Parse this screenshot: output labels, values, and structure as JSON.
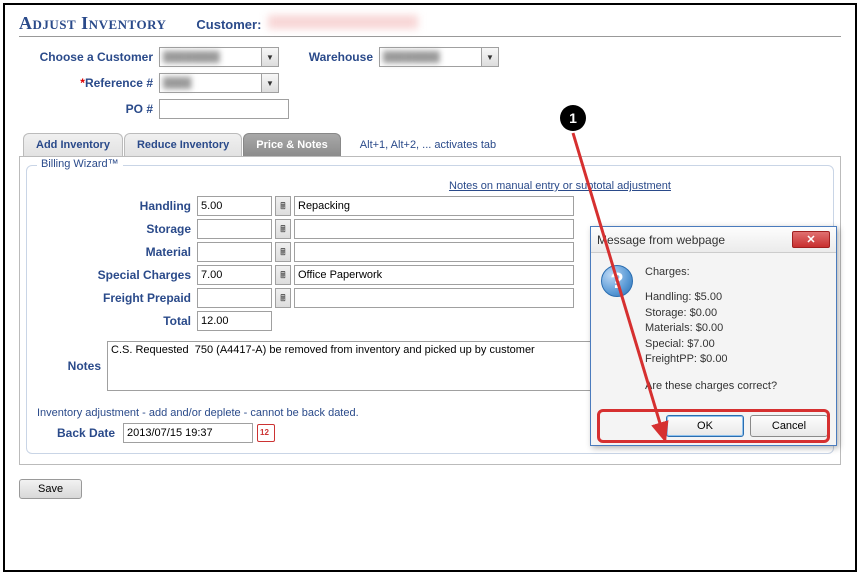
{
  "header": {
    "title": "Adjust Inventory",
    "customer_label": "Customer:"
  },
  "form": {
    "choose_customer_label": "Choose a Customer",
    "warehouse_label": "Warehouse",
    "reference_label": "Reference #",
    "po_label": "PO #"
  },
  "tabs": {
    "add": "Add Inventory",
    "reduce": "Reduce Inventory",
    "price": "Price & Notes",
    "hint": "Alt+1, Alt+2, ... activates tab"
  },
  "billing": {
    "legend": "Billing Wizard™",
    "notes_header": "Notes on manual entry or subtotal adjustment",
    "handling_label": "Handling",
    "handling_value": "5.00",
    "handling_note": "Repacking",
    "storage_label": "Storage",
    "storage_value": "",
    "storage_note": "",
    "material_label": "Material",
    "material_value": "",
    "material_note": "",
    "special_label": "Special Charges",
    "special_value": "7.00",
    "special_note": "Office Paperwork",
    "freight_label": "Freight Prepaid",
    "freight_value": "",
    "freight_note": "",
    "total_label": "Total",
    "total_value": "12.00"
  },
  "notes": {
    "label": "Notes",
    "value": "C.S. Requested  750 (A4417-A) be removed from inventory and picked up by customer"
  },
  "footer": {
    "hint": "Inventory adjustment - add and/or deplete - cannot be back dated.",
    "backdate_label": "Back Date",
    "backdate_value": "2013/07/15 19:37",
    "save_label": "Save"
  },
  "dialog": {
    "title": "Message from webpage",
    "heading": "Charges:",
    "line1": "Handling: $5.00",
    "line2": "Storage: $0.00",
    "line3": "Materials: $0.00",
    "line4": "Special: $7.00",
    "line5": "FreightPP: $0.00",
    "confirm": "Are these charges correct?",
    "ok": "OK",
    "cancel": "Cancel"
  },
  "callout": {
    "marker": "1"
  }
}
